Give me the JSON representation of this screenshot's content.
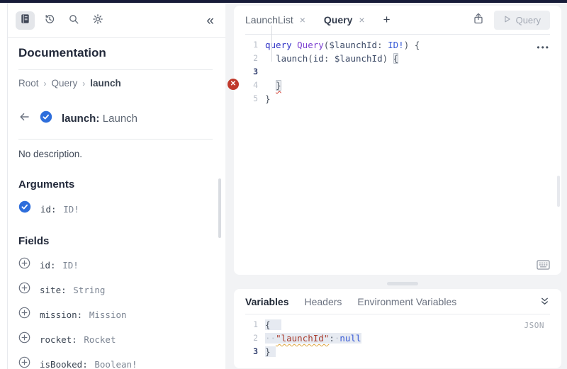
{
  "colors": {
    "top_strip": "#171c39",
    "panel_bg": "#f2f3f5",
    "accent_check": "#2e6edb",
    "error_red": "#c0392b",
    "keyword_blue": "#2d31c6",
    "operation_purple": "#7a3dd0",
    "type_blue": "#3659d6",
    "json_prop_red": "#a93c2d"
  },
  "sidebar": {
    "toolbar": {
      "collapse_glyph": "«",
      "icons": [
        "documentation",
        "history",
        "search",
        "settings"
      ]
    },
    "title": "Documentation",
    "breadcrumb": {
      "root": "Root",
      "parent": "Query",
      "current": "launch",
      "separator": "›"
    },
    "field_header": {
      "name": "launch:",
      "type": "Launch"
    },
    "description": "No description.",
    "arguments_label": "Arguments",
    "arguments": [
      {
        "name": "id:",
        "type": "ID!"
      }
    ],
    "fields_label": "Fields",
    "fields": [
      {
        "name": "id:",
        "type": "ID!"
      },
      {
        "name": "site:",
        "type": "String"
      },
      {
        "name": "mission:",
        "type": "Mission"
      },
      {
        "name": "rocket:",
        "type": "Rocket"
      },
      {
        "name": "isBooked:",
        "type": "Boolean!"
      }
    ]
  },
  "editor_panel": {
    "tabs": [
      {
        "label": "LaunchList",
        "close": "×",
        "active": false
      },
      {
        "label": "Query",
        "close": "×",
        "active": true
      }
    ],
    "new_tab_label": "+",
    "run_button_label": "Query",
    "menu_dots": "•••",
    "error_glyph": "✕",
    "code": {
      "gutter": [
        {
          "n": "1"
        },
        {
          "n": "2"
        },
        {
          "n": "3",
          "active": true
        },
        {
          "n": "4"
        },
        {
          "n": "5"
        }
      ],
      "lines": [
        [
          {
            "t": "query ",
            "c": "kw"
          },
          {
            "t": "Query",
            "c": "op"
          },
          {
            "t": "(",
            "c": "p"
          },
          {
            "t": "$launchId",
            "c": "v"
          },
          {
            "t": ": ",
            "c": "p"
          },
          {
            "t": "ID!",
            "c": "ty"
          },
          {
            "t": ") {",
            "c": "p"
          }
        ],
        [
          {
            "t": "  ",
            "c": "p"
          },
          {
            "t": "launch",
            "c": "v"
          },
          {
            "t": "(",
            "c": "p"
          },
          {
            "t": "id",
            "c": "v"
          },
          {
            "t": ": ",
            "c": "p"
          },
          {
            "t": "$launchId",
            "c": "v"
          },
          {
            "t": ") ",
            "c": "p"
          },
          {
            "t": "{",
            "c": "bh"
          }
        ],
        [],
        [
          {
            "t": "  ",
            "c": "p"
          },
          {
            "t": "}",
            "c": "bh err"
          }
        ],
        [
          {
            "t": "}",
            "c": "p"
          }
        ]
      ]
    }
  },
  "variables_panel": {
    "tabs": [
      {
        "label": "Variables",
        "active": true
      },
      {
        "label": "Headers",
        "active": false
      },
      {
        "label": "Environment Variables",
        "active": false
      }
    ],
    "mode_label": "JSON",
    "code": {
      "gutter": [
        {
          "n": "1"
        },
        {
          "n": "2"
        },
        {
          "n": "3",
          "active": true
        }
      ],
      "lines": [
        [
          {
            "t": "{",
            "c": "p sel"
          },
          {
            "t": "  ",
            "c": "sel"
          }
        ],
        [
          {
            "t": "··",
            "c": "ws sel"
          },
          {
            "t": "\"launchId\"",
            "c": "prop sel warn"
          },
          {
            "t": ":",
            "c": "p sel"
          },
          {
            "t": "·",
            "c": "ws sel"
          },
          {
            "t": "null",
            "c": "val sel"
          }
        ],
        [
          {
            "t": "}",
            "c": "p sel"
          },
          {
            "t": " ",
            "c": "sel"
          }
        ]
      ]
    }
  }
}
